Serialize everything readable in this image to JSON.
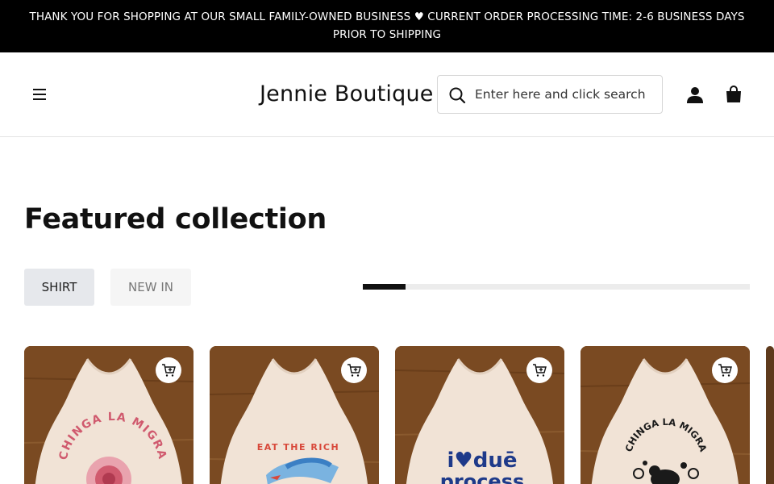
{
  "announcement": {
    "text": "THANK YOU FOR SHOPPING AT OUR SMALL FAMILY-OWNED BUSINESS ♥ CURRENT ORDER PROCESSING TIME: 2-6 BUSINESS DAYS PRIOR TO SHIPPING"
  },
  "header": {
    "brand": "Jennie Boutique",
    "menu_icon": "hamburger-menu-icon",
    "search": {
      "placeholder": "Enter here and click search",
      "icon": "search-icon"
    },
    "account_icon": "user-icon",
    "cart_icon": "shopping-bag-icon"
  },
  "featured": {
    "title": "Featured collection",
    "tabs": [
      {
        "label": "SHIRT",
        "active": true
      },
      {
        "label": "NEW IN",
        "active": false
      }
    ],
    "scroll_progress": 0.11,
    "products": [
      {
        "graphic_text": "CHINGA LA MIGRA",
        "graphic_color": "#d05a6e",
        "quick_add_icon": "cart-plus-icon"
      },
      {
        "graphic_text": "EAT THE RICH",
        "graphic_color": "#d8483a",
        "quick_add_icon": "cart-plus-icon"
      },
      {
        "graphic_text_line1": "i♥duē",
        "graphic_text_line2": "process",
        "graphic_color": "#1e3a8a",
        "heart_color": "#d8283a",
        "quick_add_icon": "cart-plus-icon"
      },
      {
        "graphic_text": "CHINGA LA MIGRA",
        "graphic_color": "#1a1a1a",
        "quick_add_icon": "cart-plus-icon"
      }
    ]
  },
  "colors": {
    "announcement_bg": "#000000",
    "active_tab_bg": "#e6e8ec",
    "inactive_tab_bg": "#f5f5f5",
    "wood": "#7a4a22",
    "tank_top": "#f1e3d6"
  }
}
